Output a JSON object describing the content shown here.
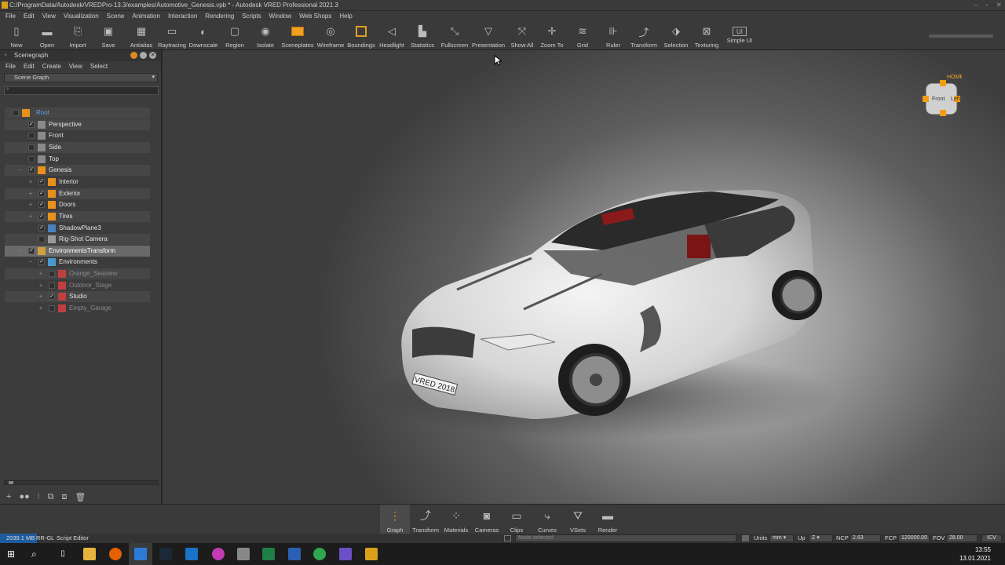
{
  "window": {
    "title": "C:/ProgramData/Autodesk/VREDPro-13.3/examples/Automotive_Genesis.vpb * - Autodesk VRED Professional 2021.3"
  },
  "menubar": [
    "File",
    "Edit",
    "View",
    "Visualization",
    "Scene",
    "Animation",
    "Interaction",
    "Rendering",
    "Scripts",
    "Window",
    "Web Shops",
    "Help"
  ],
  "toolbar": [
    {
      "label": "New",
      "icon": "new-file-icon",
      "glyph": "▯"
    },
    {
      "label": "Open",
      "icon": "folder-icon",
      "glyph": "▬"
    },
    {
      "label": "Import",
      "icon": "import-icon",
      "glyph": "⎘"
    },
    {
      "label": "Save",
      "icon": "save-icon",
      "glyph": "▣"
    },
    {
      "label": "Antialias",
      "icon": "antialias-icon",
      "glyph": "▦"
    },
    {
      "label": "Raytracing",
      "icon": "raytracing-icon",
      "glyph": "▭"
    },
    {
      "label": "Downscale",
      "icon": "downscale-icon",
      "glyph": "◐"
    },
    {
      "label": "Region",
      "icon": "region-icon",
      "glyph": "▢"
    },
    {
      "label": "Isolate",
      "icon": "isolate-icon",
      "glyph": "◉"
    },
    {
      "label": "Sceneplates",
      "icon": "sceneplates-icon",
      "glyph": ""
    },
    {
      "label": "Wireframe",
      "icon": "wireframe-icon",
      "glyph": "◎"
    },
    {
      "label": "Boundings",
      "icon": "boundings-icon",
      "glyph": ""
    },
    {
      "label": "Headlight",
      "icon": "headlight-icon",
      "glyph": "◁"
    },
    {
      "label": "Statistics",
      "icon": "statistics-icon",
      "glyph": "▙"
    },
    {
      "label": "Fullscreen",
      "icon": "fullscreen-icon",
      "glyph": "⤡"
    },
    {
      "label": "Presentation",
      "icon": "presentation-icon",
      "glyph": "▽"
    },
    {
      "label": "Show All",
      "icon": "show-all-icon",
      "glyph": "⤧"
    },
    {
      "label": "Zoom To",
      "icon": "zoom-to-icon",
      "glyph": "✛"
    },
    {
      "label": "Grid",
      "icon": "grid-icon",
      "glyph": "≋"
    },
    {
      "label": "Ruler",
      "icon": "ruler-icon",
      "glyph": "⊪"
    },
    {
      "label": "Transform",
      "icon": "transform-icon",
      "glyph": "⤴"
    },
    {
      "label": "Selection",
      "icon": "selection-icon",
      "glyph": "⬗"
    },
    {
      "label": "Texturing",
      "icon": "texturing-icon",
      "glyph": "⊠"
    },
    {
      "label": "Simple UI",
      "icon": "simple-ui-icon",
      "glyph": "UI"
    }
  ],
  "scenegraph": {
    "title": "Scenegraph",
    "menu": [
      "File",
      "Edit",
      "Create",
      "View",
      "Select"
    ],
    "view_select": "Scene Graph",
    "search_placeholder": "",
    "nodes": [
      {
        "label": "Root",
        "icon": "group-node-icon"
      },
      {
        "label": "Perspective",
        "icon": "camera-node-icon"
      },
      {
        "label": "Front",
        "icon": "camera-node-icon"
      },
      {
        "label": "Side",
        "icon": "camera-node-icon"
      },
      {
        "label": "Top",
        "icon": "camera-node-icon"
      },
      {
        "label": "Genesis",
        "icon": "group-node-icon"
      },
      {
        "label": "Interior",
        "icon": "group-node-icon"
      },
      {
        "label": "Exterior",
        "icon": "group-node-icon"
      },
      {
        "label": "Doors",
        "icon": "group-node-icon"
      },
      {
        "label": "Tires",
        "icon": "group-node-icon"
      },
      {
        "label": "ShadowPlane3",
        "icon": "geometry-node-icon"
      },
      {
        "label": "Rig-Shot Camera",
        "icon": "camera-rig-icon"
      },
      {
        "label": "EnvironmentsTransform",
        "icon": "transform-node-icon"
      },
      {
        "label": "Environments",
        "icon": "switch-node-icon"
      },
      {
        "label": "Orange_Seaview",
        "icon": "environment-node-icon"
      },
      {
        "label": "Outdoor_Stage",
        "icon": "environment-node-icon"
      },
      {
        "label": "Studio",
        "icon": "environment-node-icon"
      },
      {
        "label": "Empty_Garage",
        "icon": "environment-node-icon"
      }
    ]
  },
  "viewport": {
    "viewcube_home": "HOME",
    "viewcube_front": "Front",
    "viewcube_left": "Left",
    "license_plate": "VRED 2018",
    "accent_orange": "#f5a623"
  },
  "dock": [
    {
      "label": "Graph",
      "icon": "graph-icon",
      "glyph": "⋮"
    },
    {
      "label": "Transform",
      "icon": "transform-icon",
      "glyph": "⤴"
    },
    {
      "label": "Materials",
      "icon": "materials-icon",
      "glyph": "⁘"
    },
    {
      "label": "Cameras",
      "icon": "cameras-icon",
      "glyph": "◙"
    },
    {
      "label": "Clips",
      "icon": "clips-icon",
      "glyph": "▭"
    },
    {
      "label": "Curves",
      "icon": "curves-icon",
      "glyph": "⤷"
    },
    {
      "label": "VSets",
      "icon": "vsets-icon",
      "glyph": "⛛"
    },
    {
      "label": "Render",
      "icon": "render-icon",
      "glyph": "▬"
    }
  ],
  "statusbar": {
    "memory": "2039.1 MB",
    "render_mode": "RR-GL",
    "script_editor": "Script Editor",
    "command_placeholder": "Node selected",
    "units_label": "Units",
    "units_value": "mm",
    "up_label": "Up",
    "up_value": "Z",
    "ncp_label": "NCP",
    "ncp_value": "2.63",
    "fcp_label": "FCP",
    "fcp_value": "120000.00",
    "fov_label": "FOV",
    "fov_value": "28.00",
    "icv": "ICV"
  },
  "taskbar": {
    "time": "13:55",
    "date": "13.01.2021"
  }
}
